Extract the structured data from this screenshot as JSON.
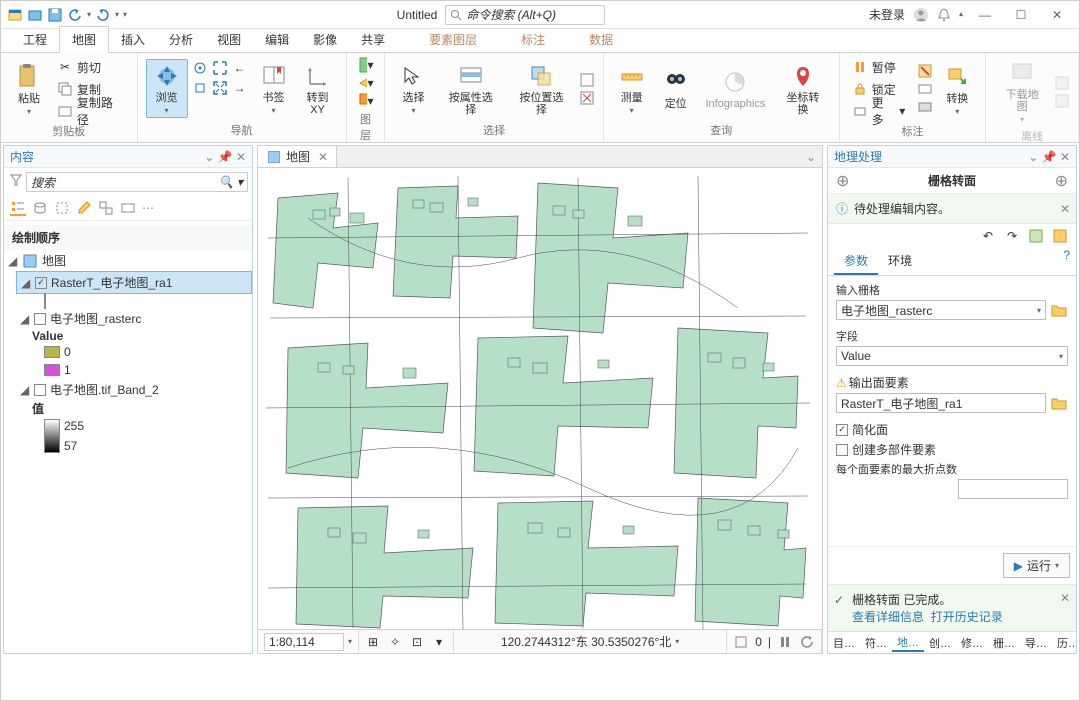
{
  "title": "Untitled",
  "search_placeholder": "命令搜索 (Alt+Q)",
  "login": "未登录",
  "tabs": {
    "t0": "工程",
    "t1": "地图",
    "t2": "插入",
    "t3": "分析",
    "t4": "视图",
    "t5": "编辑",
    "t6": "影像",
    "t7": "共享",
    "c0": "要素图层",
    "c1": "标注",
    "c2": "数据"
  },
  "ribbon": {
    "clipboard": {
      "paste": "粘贴",
      "cut": "剪切",
      "copy": "复制",
      "copypath": "复制路径",
      "group": "剪贴板"
    },
    "nav": {
      "browse": "浏览",
      "bookmark": "书签",
      "goto": "转到\nXY",
      "group": "导航"
    },
    "layer": {
      "group": "图层"
    },
    "select": {
      "sel": "选择",
      "attr": "按属性选择",
      "loc": "按位置选择",
      "group": "选择"
    },
    "query": {
      "measure": "测量",
      "locate": "定位",
      "info": "Infographics",
      "coord": "坐标转换",
      "group": "查询"
    },
    "annot": {
      "pause": "暂停",
      "lock": "锁定",
      "more": "更多",
      "convert": "转换",
      "group": "标注"
    },
    "offline": {
      "download": "下载地图",
      "group": "离线"
    }
  },
  "toc": {
    "title": "内容",
    "search": "搜索",
    "order": "绘制顺序",
    "map": "地图",
    "l1": "RasterT_电子地图_ra1",
    "l2": "电子地图_rasterc",
    "l2v": "Value",
    "l2a": "0",
    "l2b": "1",
    "l3": "电子地图.tif_Band_2",
    "l3v": "值",
    "l3a": "255",
    "l3b": "57"
  },
  "map": {
    "tab": "地图",
    "scale": "1:80,114",
    "coords": "120.2744312°东 30.5350276°北",
    "rot": "0"
  },
  "gp": {
    "title": "地理处理",
    "tool": "栅格转面",
    "msg": "待处理编辑内容。",
    "tab_param": "参数",
    "tab_env": "环境",
    "p1": "输入栅格",
    "v1": "电子地图_rasterc",
    "p2": "字段",
    "v2": "Value",
    "p3": "输出面要素",
    "v3": "RasterT_电子地图_ra1",
    "c1": "简化面",
    "c2": "创建多部件要素",
    "p4": "每个面要素的最大折点数",
    "run": "运行",
    "done": "栅格转面 已完成。",
    "link1": "查看详细信息",
    "link2": "打开历史记录"
  },
  "btabs": {
    "a": "目…",
    "b": "符…",
    "c": "地…",
    "d": "创…",
    "e": "修…",
    "f": "栅…",
    "g": "导…",
    "h": "历…"
  }
}
